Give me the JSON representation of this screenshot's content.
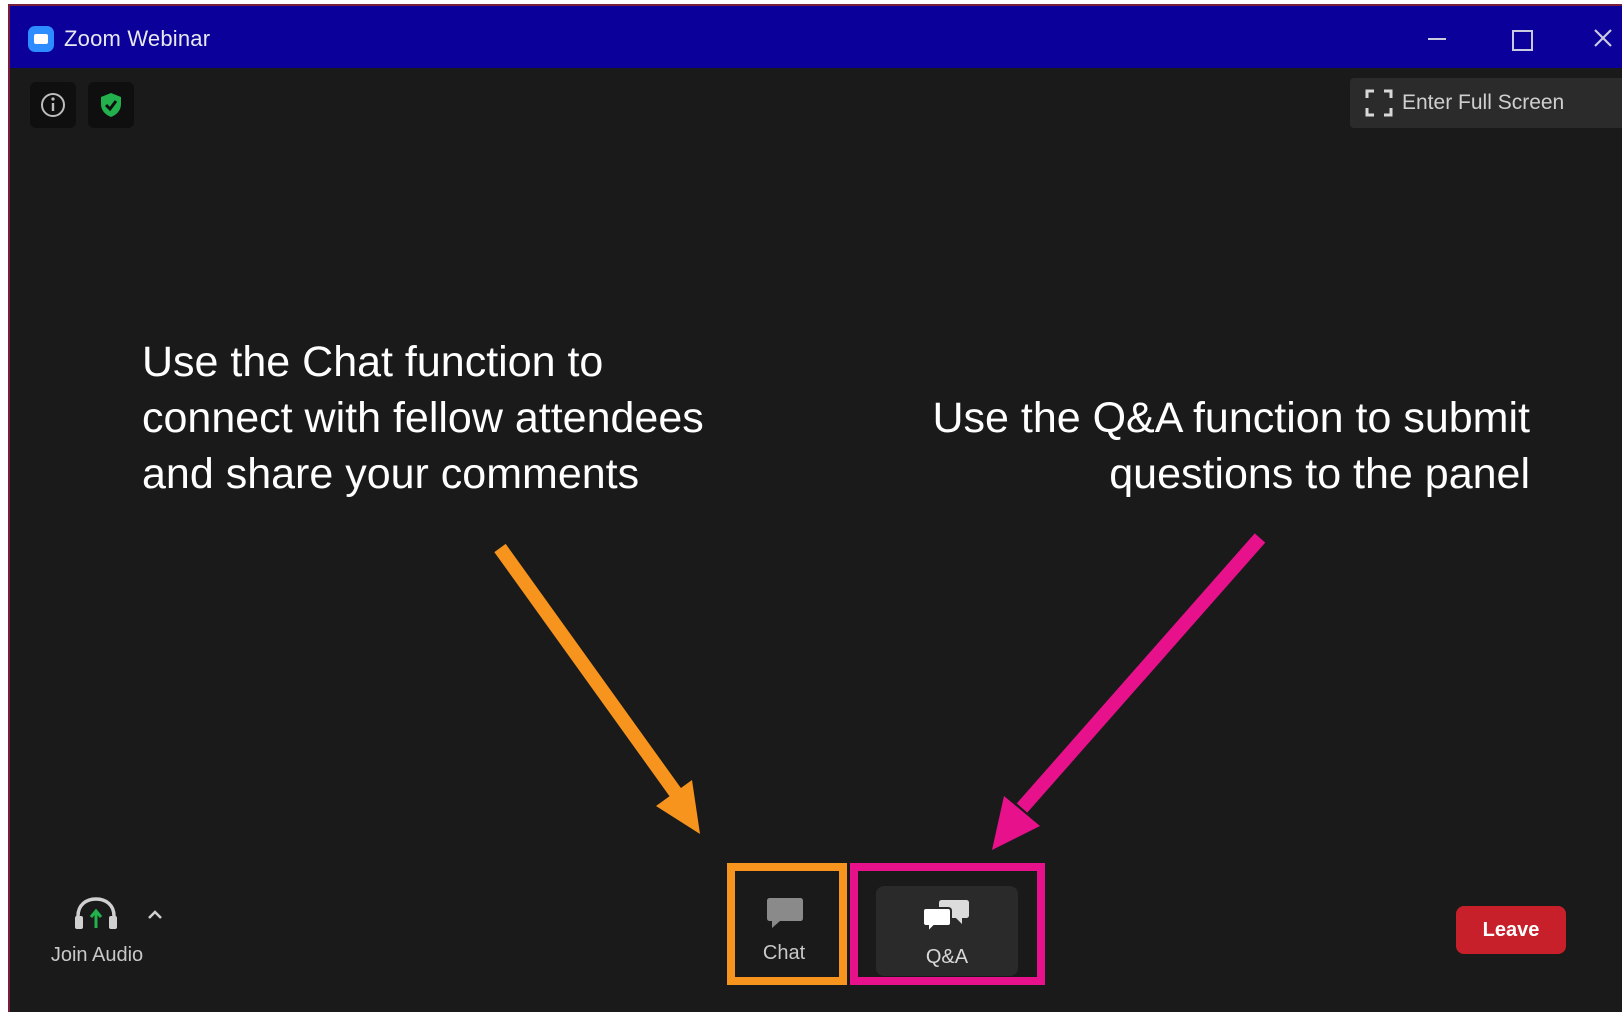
{
  "window": {
    "title": "Zoom Webinar"
  },
  "header": {
    "fullscreen_label": "Enter Full Screen"
  },
  "annotations": {
    "chat": "Use the Chat function to connect with fellow attendees and share your comments",
    "qa": "Use the Q&A function to submit questions to the panel",
    "chat_color": "#f7941d",
    "qa_color": "#e8118c"
  },
  "toolbar": {
    "join_audio_label": "Join Audio",
    "chat_label": "Chat",
    "qa_label": "Q&A",
    "leave_label": "Leave"
  },
  "icons": {
    "app": "zoom-app-icon",
    "info": "info-icon",
    "security": "shield-check-icon",
    "fullscreen": "fullscreen-icon",
    "audio": "headphones-icon",
    "chat": "chat-bubble-icon",
    "qa": "qa-bubbles-icon"
  },
  "colors": {
    "titlebar": "#0b0099",
    "background": "#1a1a1a",
    "leave": "#c8202a",
    "shield": "#22b14c"
  }
}
